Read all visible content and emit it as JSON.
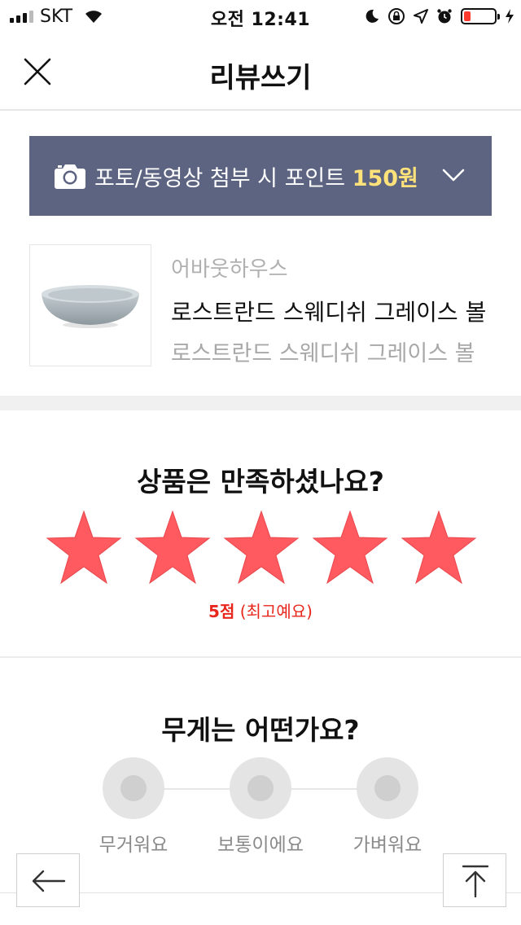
{
  "status_bar": {
    "carrier": "SKT",
    "time": "오전 12:41"
  },
  "nav": {
    "title": "리뷰쓰기",
    "close_icon": "close-icon"
  },
  "photo_banner": {
    "text": "포토/동영상 첨부 시 포인트",
    "points": "150원",
    "color": "#5c6482",
    "points_color": "#ffe27a"
  },
  "product": {
    "brand": "어바웃하우스",
    "name": "로스트란드 스웨디쉬 그레이스 볼",
    "option": "로스트란드 스웨디쉬 그레이스 볼"
  },
  "rating": {
    "question": "상품은 만족하셨나요?",
    "value": 5,
    "max": 5,
    "score_text": "5점",
    "score_label": "(최고예요)",
    "star_color": "#ff5a5f"
  },
  "weight": {
    "question": "무게는 어떤가요?",
    "options": [
      "무거워요",
      "보통이에요",
      "가벼워요"
    ]
  },
  "floating": {
    "back_icon": "arrow-left-icon",
    "top_icon": "scroll-top-icon"
  }
}
